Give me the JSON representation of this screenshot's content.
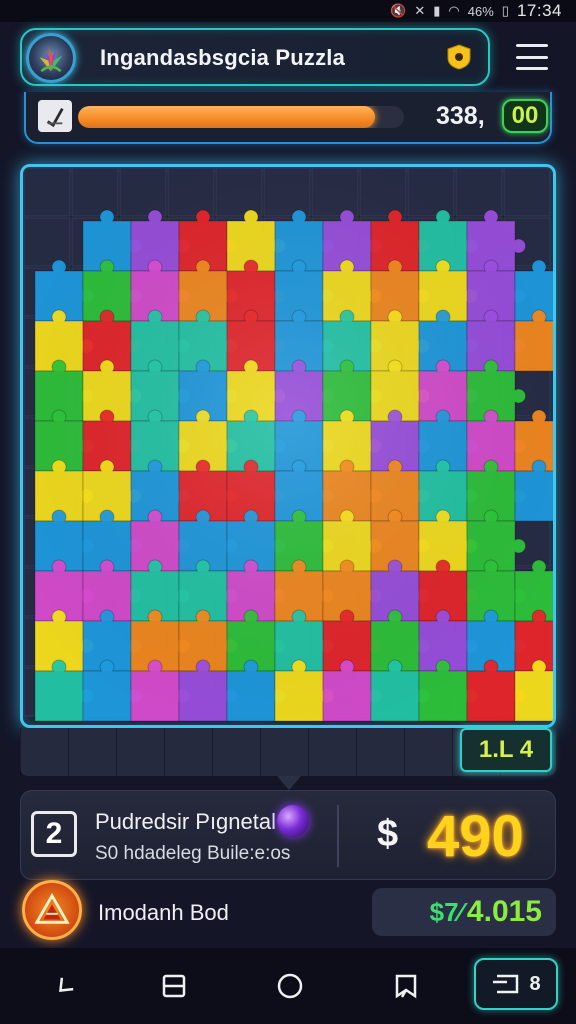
{
  "status_bar": {
    "battery": "46%",
    "time": "17:34",
    "icons": [
      "mute-icon",
      "no-sim-icon",
      "signal-icon",
      "wifi-icon",
      "battery-icon"
    ]
  },
  "header": {
    "app_title": "Ingandasbsgcia Puzzla",
    "logo_icon": "flower-logo-icon",
    "shield_icon": "shield-icon",
    "menu_icon": "hamburger-menu-icon"
  },
  "progress": {
    "fraction": 0.91,
    "score": "338,",
    "badge": "00"
  },
  "board": {
    "level_badge": "1.L 4"
  },
  "info_panel": {
    "level_number": "2",
    "title": "Pudredsir Pıgnetal",
    "subtitle": "S0 hdadeleg Buile:e:os",
    "currency_symbol": "$",
    "score": "490"
  },
  "user": {
    "name": "Imodanh Bod",
    "currency": "$7⁄",
    "amount": "4.015"
  },
  "nav": {
    "recents_count": "8"
  },
  "colors": {
    "accent_cyan": "#3cc8f0",
    "progress_orange": "#f58a26",
    "score_gold": "#ffd21c",
    "money_green": "#8aec3e"
  }
}
